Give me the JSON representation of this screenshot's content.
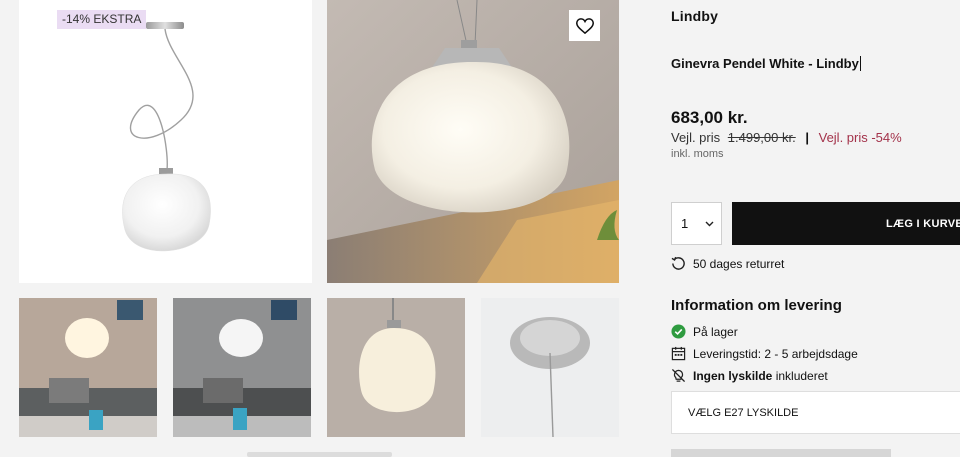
{
  "gallery": {
    "badge": "-14% EKSTRA",
    "wishlist_icon": "heart-outline-icon",
    "thumbnails": [
      "livingroom-warm",
      "livingroom-grey",
      "lamp-closeup",
      "ceiling-canopy"
    ]
  },
  "product": {
    "brand": "Lindby",
    "title": "Ginevra Pendel White - Lindby",
    "price": "683,00 kr.",
    "rrp_label": "Vejl. pris",
    "rrp_old": "1.499,00 kr.",
    "separator": "|",
    "rrp_discount": "Vejl. pris -54%",
    "vat_note": "inkl. moms",
    "quantity": "1",
    "add_to_cart": "LÆG I KURVEN",
    "returns": "50 dages returret"
  },
  "delivery": {
    "title": "Information om levering",
    "stock": "På lager",
    "leadtime": "Leveringstid: 2 - 5 arbejdsdage",
    "bulb_bold": "Ingen lyskilde",
    "bulb_rest": "inkluderet",
    "select_bulb": "VÆLG E27 LYSKILDE"
  },
  "colors": {
    "accent": "#a3324a",
    "badge_bg": "#eadcf3",
    "button_bg": "#111111",
    "stock_green": "#2e9b3f"
  }
}
